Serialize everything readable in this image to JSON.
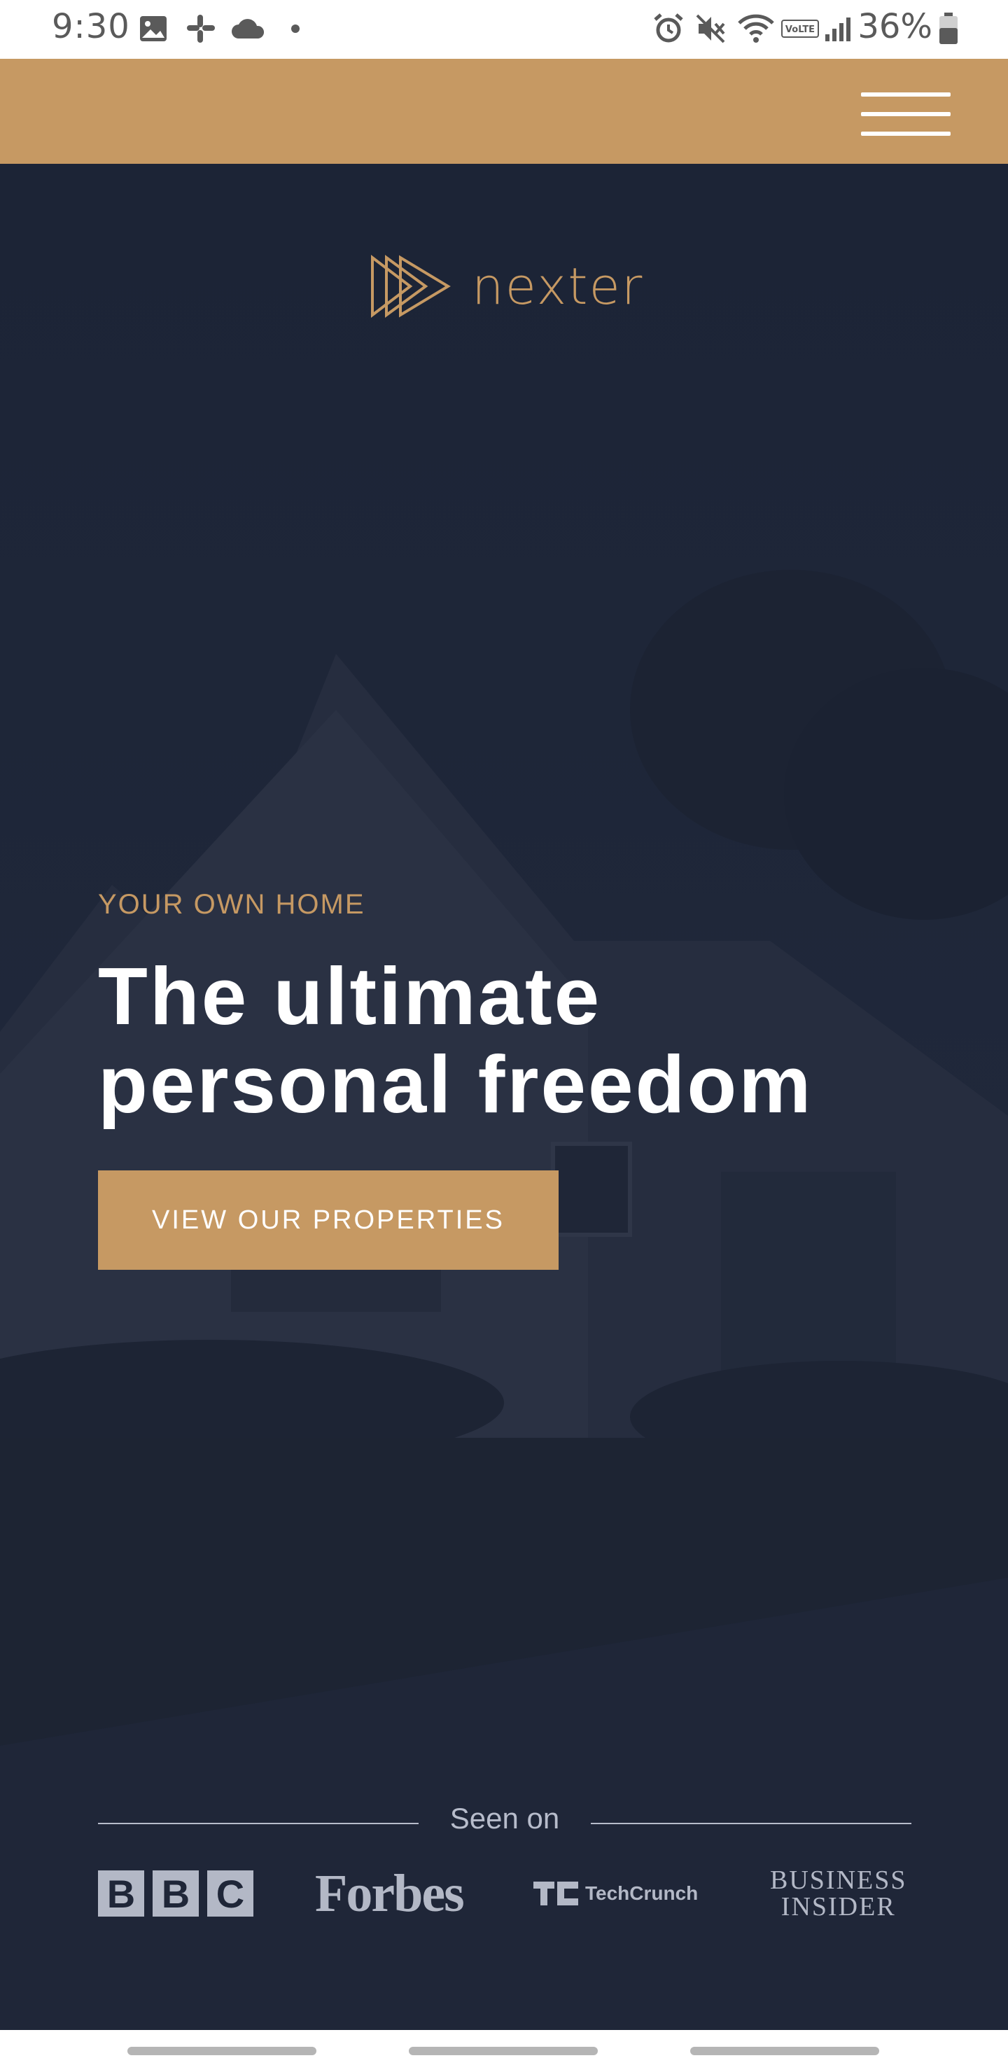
{
  "status_bar": {
    "time": "9:30",
    "battery": "36%",
    "icons": [
      "gallery-icon",
      "slack-icon",
      "cloud-icon",
      "dot-icon",
      "alarm-icon",
      "mute-icon",
      "wifi-icon",
      "volte-icon",
      "signal-icon",
      "battery-icon"
    ]
  },
  "colors": {
    "accent": "#c69963",
    "hero_bg": "#1f2638",
    "text_light": "#ffffff",
    "muted": "#b7bccb"
  },
  "header": {
    "menu_icon": "hamburger-menu-icon"
  },
  "hero": {
    "logo_text": "nexter",
    "eyebrow": "YOUR OWN HOME",
    "headline_line1": "The ultimate",
    "headline_line2": "personal freedom",
    "cta_label": "VIEW OUR PROPERTIES"
  },
  "seen_on": {
    "label": "Seen on",
    "logos": [
      "BBC",
      "Forbes",
      "TechCrunch",
      "BUSINESS INSIDER"
    ],
    "bbc": [
      "B",
      "B",
      "C"
    ],
    "forbes": "Forbes",
    "techcrunch": "TechCrunch",
    "bi_line1": "BUSINESS",
    "bi_line2": "INSIDER"
  }
}
